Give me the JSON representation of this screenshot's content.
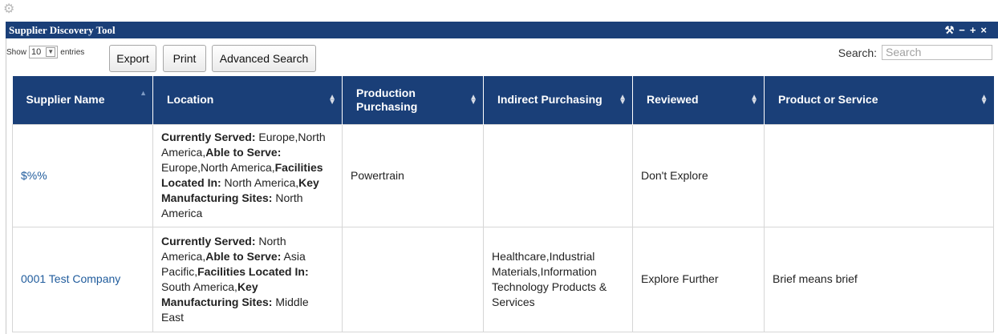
{
  "window": {
    "title": "Supplier Discovery Tool",
    "controls": [
      "wrench",
      "minimize",
      "maximize",
      "close"
    ]
  },
  "toolbar": {
    "show_label": "Show",
    "entries_value": "10",
    "entries_label": "entries",
    "export_label": "Export",
    "print_label": "Print",
    "advanced_search_label": "Advanced Search"
  },
  "search": {
    "label": "Search:",
    "placeholder": "Search"
  },
  "table": {
    "columns": [
      "Supplier Name",
      "Location",
      "Production Purchasing",
      "Indirect Purchasing",
      "Reviewed",
      "Product or Service"
    ],
    "rows": [
      {
        "supplier_name": "$%%",
        "location": [
          {
            "label": "Currently Served:",
            "value": " Europe,North America,"
          },
          {
            "label": "Able to Serve:",
            "value": " Europe,North America,"
          },
          {
            "label": "Facilities Located In:",
            "value": " North America,"
          },
          {
            "label": "Key Manufacturing Sites:",
            "value": " North America"
          }
        ],
        "production_purchasing": "Powertrain",
        "indirect_purchasing": "",
        "reviewed": "Don't Explore",
        "product_or_service": ""
      },
      {
        "supplier_name": "0001 Test Company",
        "location": [
          {
            "label": "Currently Served:",
            "value": " North America,"
          },
          {
            "label": "Able to Serve:",
            "value": " Asia Pacific,"
          },
          {
            "label": "Facilities Located In:",
            "value": " South America,"
          },
          {
            "label": "Key Manufacturing Sites:",
            "value": " Middle East"
          }
        ],
        "production_purchasing": "",
        "indirect_purchasing": "Healthcare,Industrial Materials,Information Technology Products & Services",
        "reviewed": "Explore Further",
        "product_or_service": "Brief means brief"
      }
    ]
  },
  "colors": {
    "header_bg": "#1a3f78",
    "link": "#1f5b9c"
  }
}
